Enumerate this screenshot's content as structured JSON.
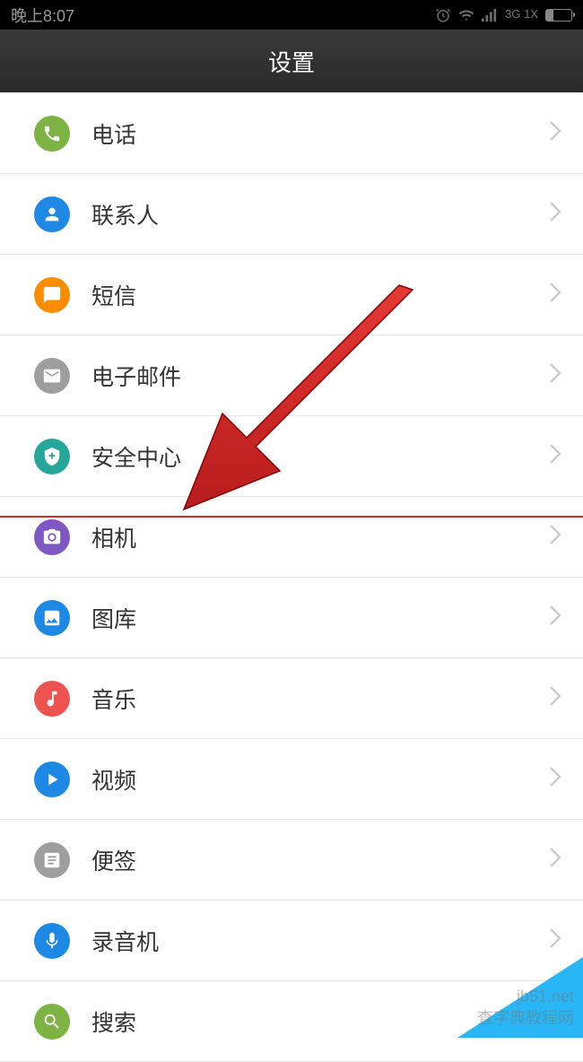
{
  "statusBar": {
    "time": "晚上8:07",
    "signal": "3G 1X"
  },
  "header": {
    "title": "设置"
  },
  "items": [
    {
      "label": "电话",
      "icon": "phone",
      "color": "bg-green"
    },
    {
      "label": "联系人",
      "icon": "person",
      "color": "bg-blue"
    },
    {
      "label": "短信",
      "icon": "chat",
      "color": "bg-orange"
    },
    {
      "label": "电子邮件",
      "icon": "mail",
      "color": "bg-gray"
    },
    {
      "label": "安全中心",
      "icon": "shield",
      "color": "bg-teal"
    },
    {
      "label": "相机",
      "icon": "camera",
      "color": "bg-purple"
    },
    {
      "label": "图库",
      "icon": "gallery",
      "color": "bg-blue2"
    },
    {
      "label": "音乐",
      "icon": "music",
      "color": "bg-coral"
    },
    {
      "label": "视频",
      "icon": "play",
      "color": "bg-blue3"
    },
    {
      "label": "便签",
      "icon": "note",
      "color": "bg-gray2"
    },
    {
      "label": "录音机",
      "icon": "recorder",
      "color": "bg-blue4"
    },
    {
      "label": "搜索",
      "icon": "search",
      "color": "bg-green2"
    }
  ],
  "annotation": {
    "highlightIndex": 5
  },
  "watermark": {
    "text1": "jb51.net",
    "text2": "查字典教程网"
  }
}
